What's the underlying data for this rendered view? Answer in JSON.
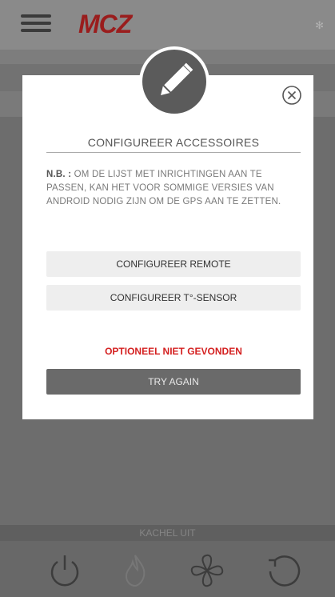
{
  "header": {
    "logo_text": "MCZ",
    "menu_icon": "hamburger-menu-icon",
    "settings_icon": "gear-icon",
    "accent_color": "#9a1d1d"
  },
  "status": {
    "text": "KACHEL UIT"
  },
  "bottom_nav": {
    "icons": [
      "power-icon",
      "flame-icon",
      "fan-icon",
      "refresh-icon"
    ]
  },
  "dialog": {
    "header_icon": "pencil-icon",
    "close_icon": "close-circle-icon",
    "title": "CONFIGUREER ACCESSOIRES",
    "note_label": "N.B. :",
    "note_text": " OM DE LIJST MET INRICHTINGEN AAN TE PASSEN, KAN HET VOOR SOMMIGE VERSIES VAN ANDROID NODIG ZIJN OM DE GPS AAN TE ZETTEN.",
    "configure_remote_label": "CONFIGUREER REMOTE",
    "configure_sensor_label": "CONFIGUREER T°-SENSOR",
    "error_text": "OPTIONEEL NIET GEVONDEN",
    "error_color": "#d42020",
    "retry_label": "TRY AGAIN"
  }
}
